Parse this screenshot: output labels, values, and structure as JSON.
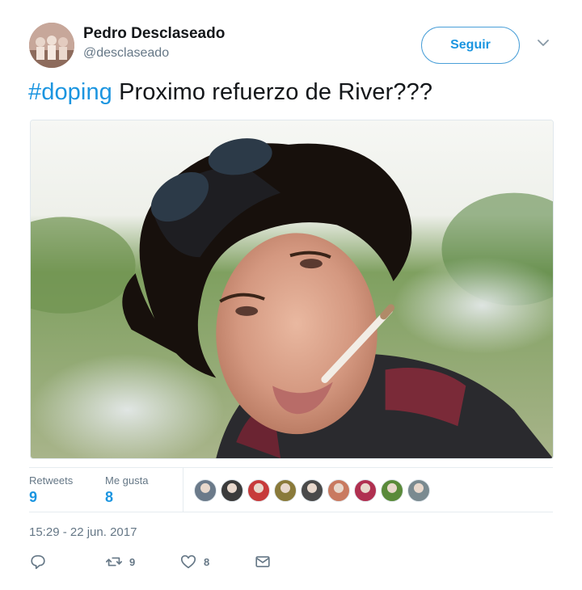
{
  "user": {
    "display_name": "Pedro Desclaseado",
    "username": "@desclaseado",
    "avatar_icon": "user-avatar"
  },
  "follow": {
    "label": "Seguir"
  },
  "tweet": {
    "hashtag": "#doping",
    "text": " Proximo refuerzo de River???"
  },
  "media": {
    "alt_icon": "photo"
  },
  "stats": {
    "retweets": {
      "label": "Retweets",
      "value": "9"
    },
    "likes": {
      "label": "Me gusta",
      "value": "8"
    },
    "liker_colors": [
      "#6b7a8a",
      "#3b3b3b",
      "#c73b3b",
      "#8a7a3a",
      "#4a4a4a",
      "#c97a60",
      "#b03050",
      "#5a8a3a",
      "#7a8a90"
    ]
  },
  "timestamp": "15:29 - 22 jun. 2017",
  "actions": {
    "reply_icon": "reply-icon",
    "retweet_count": "9",
    "like_count": "8",
    "dm_icon": "envelope-icon"
  },
  "colors": {
    "accent": "#1b95e0",
    "secondary_text": "#657786",
    "border": "#e6ecf0"
  }
}
